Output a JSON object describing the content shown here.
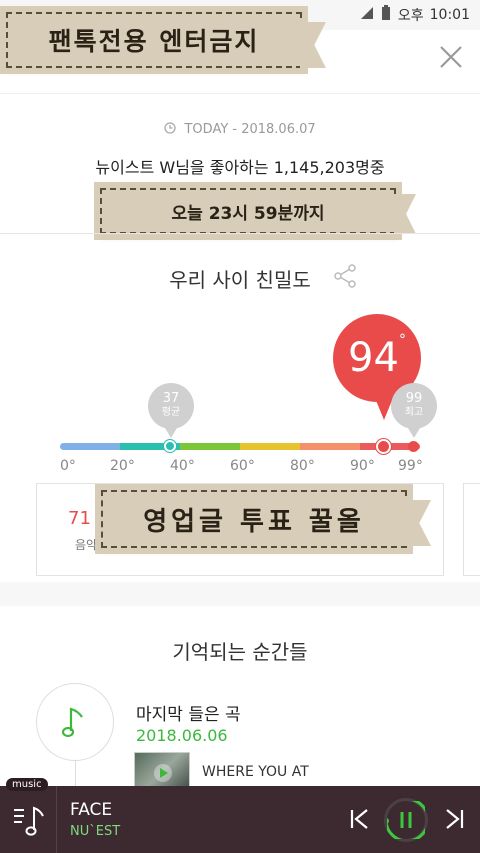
{
  "status_bar": {
    "ampm": "오후",
    "time": "10:01"
  },
  "banners": {
    "top": "팬톡전용 엔터금지",
    "middle": "영업글 투표 꿀올",
    "deadline": "오늘 23시 59분까지"
  },
  "header": {
    "date_line": "TODAY - 2018.06.07",
    "fans_line": "뉴이스트 W님을 좋아하는 1,145,203명중"
  },
  "intimacy": {
    "title": "우리 사이 친밀도",
    "score": "94",
    "degree": "°",
    "average_value": "37",
    "average_label": "평균",
    "max_value": "99",
    "max_label": "최고",
    "ticks": [
      "0°",
      "20°",
      "40°",
      "60°",
      "80°",
      "90°",
      "99°"
    ],
    "colors": [
      "#7fb0e8",
      "#2bbfb0",
      "#7cc63a",
      "#e6c42f",
      "#f4906c",
      "#ec5b5b"
    ]
  },
  "card": {
    "number": "71",
    "label": "음악"
  },
  "moments": {
    "title": "기억되는 순간들",
    "item_label": "마지막 들은 곡",
    "item_date": "2018.06.06",
    "song_title": "WHERE YOU AT"
  },
  "player": {
    "tag": "music",
    "title": "FACE",
    "artist": "NU`EST"
  }
}
